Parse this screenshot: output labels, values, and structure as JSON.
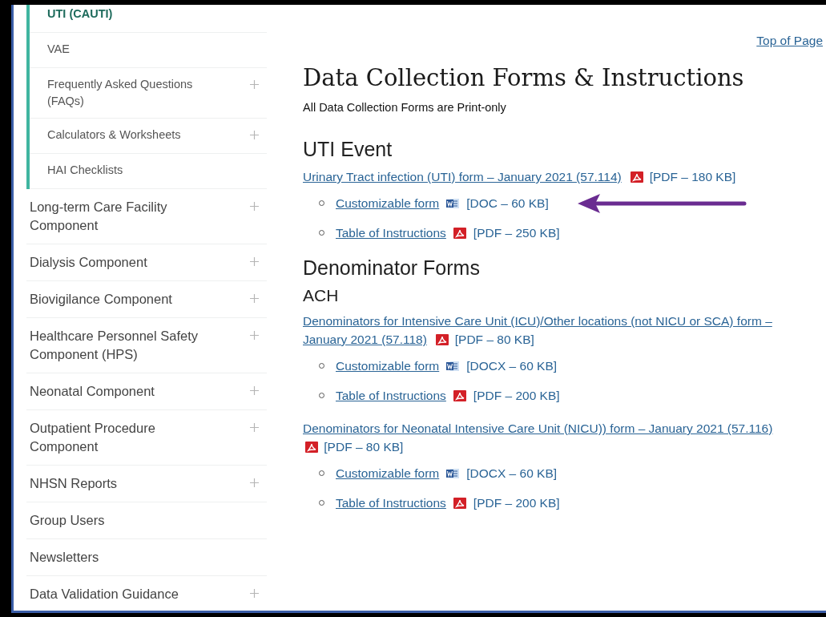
{
  "sidebar": {
    "sub_items": [
      {
        "label": "UTI (CAUTI)",
        "selected": true,
        "expandable": false
      },
      {
        "label": "VAE",
        "selected": false,
        "expandable": false
      },
      {
        "label": "Frequently Asked Questions (FAQs)",
        "selected": false,
        "expandable": true
      },
      {
        "label": "Calculators & Worksheets",
        "selected": false,
        "expandable": true
      },
      {
        "label": "HAI Checklists",
        "selected": false,
        "expandable": false
      }
    ],
    "items": [
      {
        "label": "Long-term Care Facility Component",
        "expandable": true
      },
      {
        "label": "Dialysis Component",
        "expandable": true
      },
      {
        "label": "Biovigilance Component",
        "expandable": true
      },
      {
        "label": "Healthcare Personnel Safety Component (HPS)",
        "expandable": true
      },
      {
        "label": "Neonatal Component",
        "expandable": true
      },
      {
        "label": "Outpatient Procedure Component",
        "expandable": true
      },
      {
        "label": "NHSN Reports",
        "expandable": true
      },
      {
        "label": "Group Users",
        "expandable": false
      },
      {
        "label": "Newsletters",
        "expandable": false
      },
      {
        "label": "Data Validation Guidance",
        "expandable": true
      }
    ]
  },
  "top_link": "Top of Page",
  "title": "Data Collection Forms & Instructions",
  "subtitle": "All Data Collection Forms are Print-only",
  "sections": [
    {
      "heading": "UTI Event",
      "groups": [
        {
          "entries": [
            {
              "link": "Urinary Tract infection (UTI) form – January 2021 (57.114)",
              "kind": "pdf",
              "size": "[PDF – 180 KB]",
              "sub_links": [
                {
                  "link": "Customizable form",
                  "kind": "word",
                  "size": "[DOC – 60 KB]",
                  "highlighted": true
                },
                {
                  "link": "Table of Instructions",
                  "kind": "pdf",
                  "size": "[PDF – 250 KB]",
                  "highlighted": false
                }
              ]
            }
          ]
        }
      ]
    },
    {
      "heading": "Denominator Forms",
      "groups": [
        {
          "subheading": "ACH",
          "entries": [
            {
              "link": "Denominators for Intensive Care Unit (ICU)/Other locations (not NICU or SCA) form – January 2021 (57.118)",
              "kind": "pdf",
              "size": "[PDF – 80 KB]",
              "sub_links": [
                {
                  "link": "Customizable form",
                  "kind": "word",
                  "size": "[DOCX – 60 KB]",
                  "highlighted": false
                },
                {
                  "link": "Table of Instructions",
                  "kind": "pdf",
                  "size": "[PDF – 200 KB]",
                  "highlighted": false
                }
              ]
            },
            {
              "link": "Denominators for Neonatal Intensive Care Unit (NICU)) form – January 2021 (57.116)",
              "kind": "pdf",
              "size": "[PDF – 80 KB]",
              "sub_links": [
                {
                  "link": "Customizable form",
                  "kind": "word",
                  "size": "[DOCX – 60 KB]",
                  "highlighted": false
                },
                {
                  "link": "Table of Instructions",
                  "kind": "pdf",
                  "size": "[PDF – 200 KB]",
                  "highlighted": false
                }
              ]
            }
          ]
        }
      ]
    }
  ]
}
